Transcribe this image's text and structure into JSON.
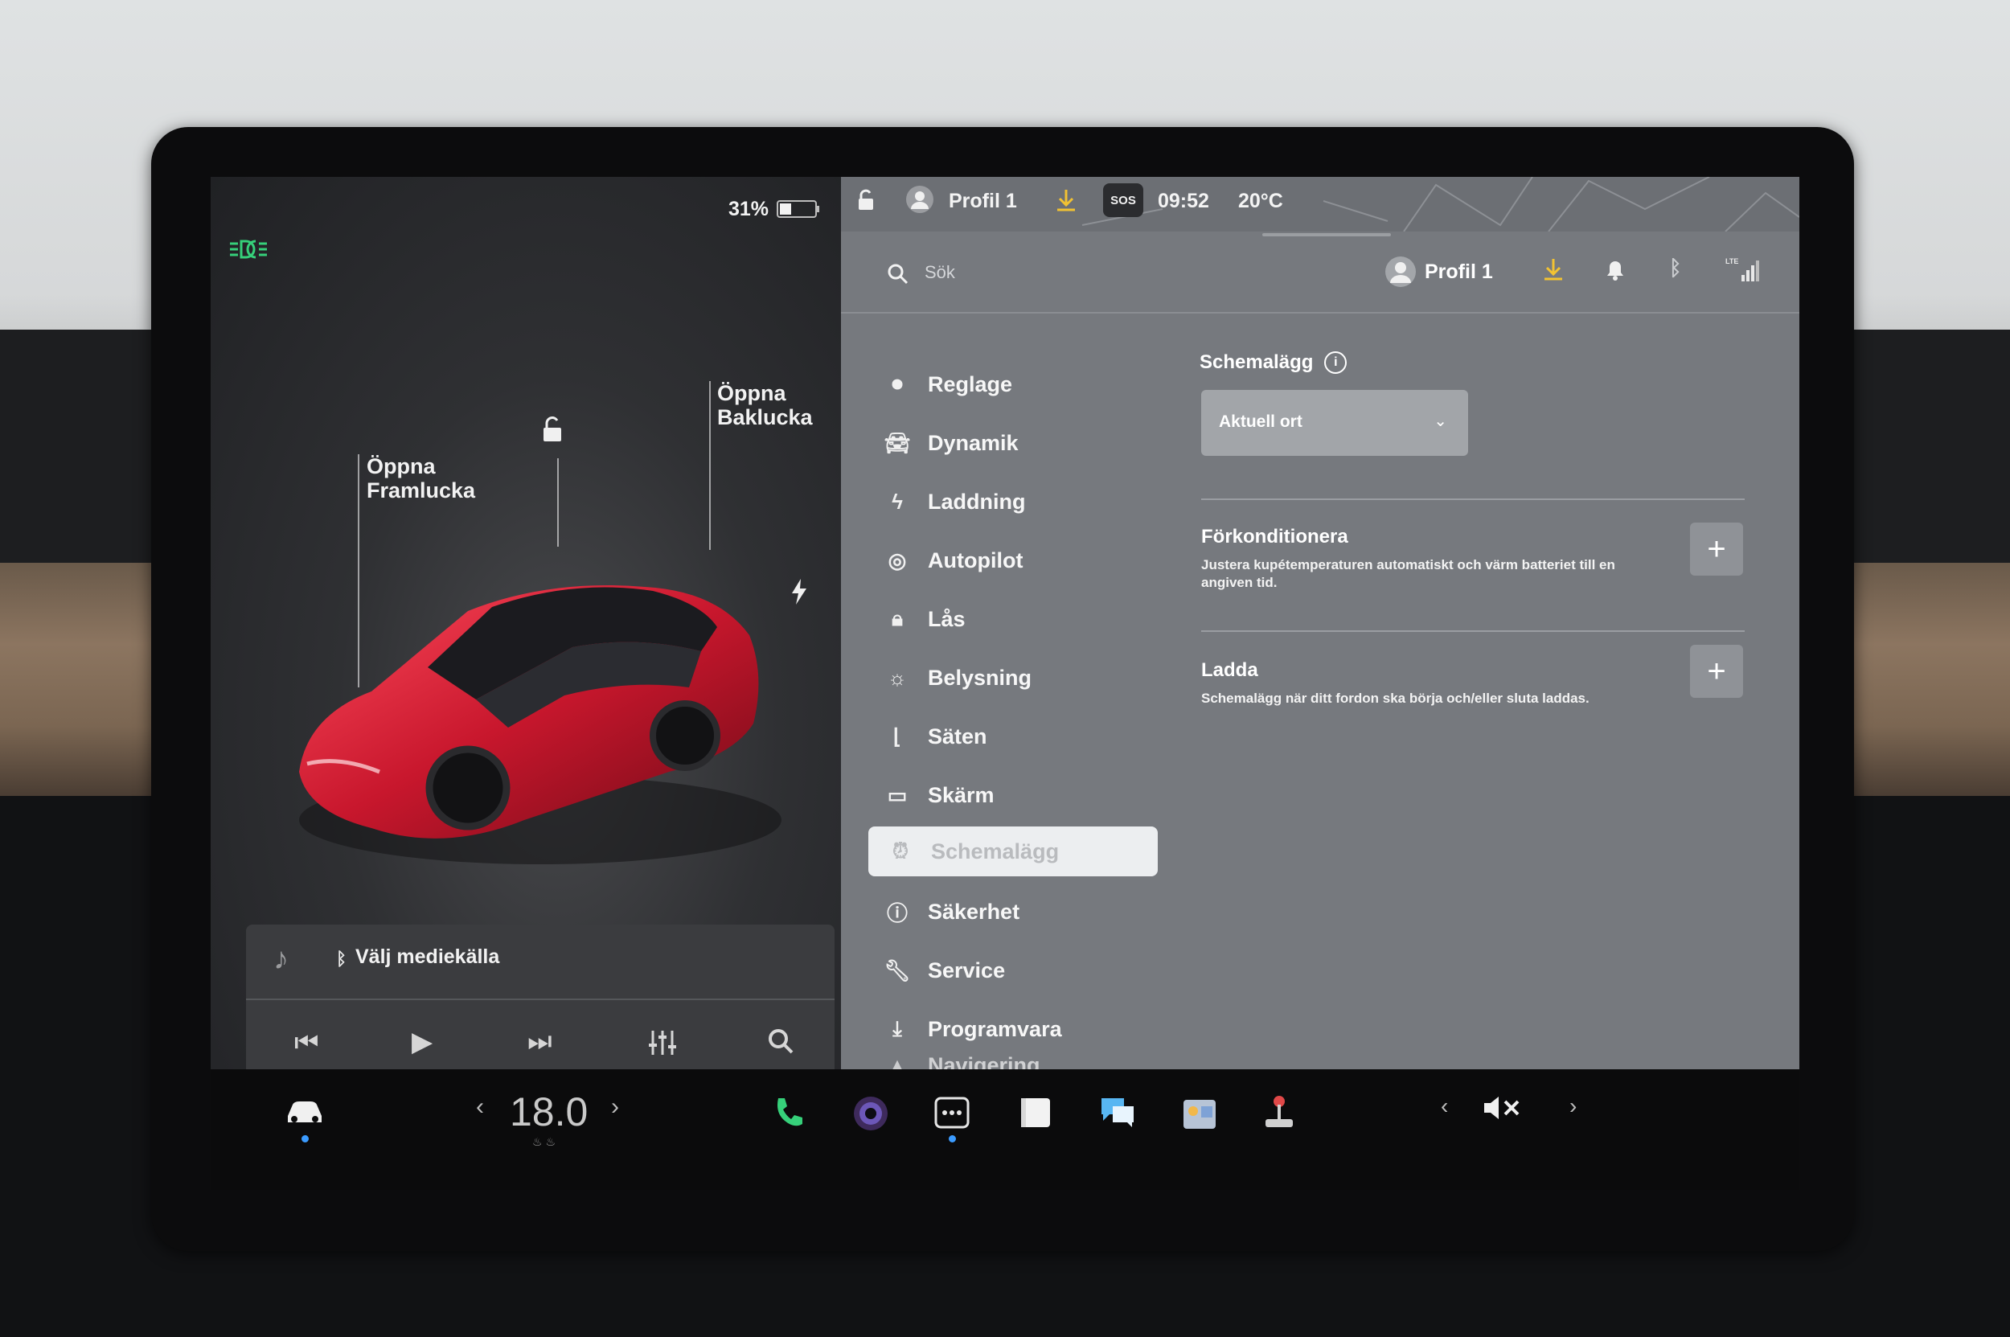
{
  "status": {
    "battery_percent": "31%",
    "profile_top": "Profil 1",
    "sos": "SOS",
    "time": "09:52",
    "temperature_outside": "20°C"
  },
  "car": {
    "front_trunk_label_1": "Öppna",
    "front_trunk_label_2": "Framlucka",
    "rear_trunk_label_1": "Öppna",
    "rear_trunk_label_2": "Baklucka"
  },
  "search": {
    "placeholder": "Sök"
  },
  "header": {
    "profile": "Profil 1"
  },
  "menu": {
    "items": [
      {
        "label": "Reglage",
        "icon": "toggle-icon"
      },
      {
        "label": "Dynamik",
        "icon": "car-icon"
      },
      {
        "label": "Laddning",
        "icon": "bolt-icon"
      },
      {
        "label": "Autopilot",
        "icon": "steering-wheel-icon"
      },
      {
        "label": "Lås",
        "icon": "lock-icon"
      },
      {
        "label": "Belysning",
        "icon": "sun-icon"
      },
      {
        "label": "Säten",
        "icon": "seat-icon"
      },
      {
        "label": "Skärm",
        "icon": "screen-icon"
      },
      {
        "label": "Schemalägg",
        "icon": "alarm-clock-icon",
        "active": true
      },
      {
        "label": "Säkerhet",
        "icon": "alert-icon"
      },
      {
        "label": "Service",
        "icon": "wrench-icon"
      },
      {
        "label": "Programvara",
        "icon": "download-icon"
      },
      {
        "label": "Navigering",
        "icon": "navigation-icon"
      }
    ]
  },
  "schedule": {
    "title": "Schemalägg",
    "location_value": "Aktuell ort",
    "precondition_title": "Förkonditionera",
    "precondition_desc": "Justera kupétemperaturen automatiskt och värm batteriet till en angiven tid.",
    "charge_title": "Ladda",
    "charge_desc": "Schemalägg när ditt fordon ska börja och/eller sluta laddas."
  },
  "media": {
    "source": "Välj mediekälla"
  },
  "climate": {
    "temperature": "18.0"
  },
  "colors": {
    "accent_green": "#36d07a",
    "download_yellow": "#f2c232",
    "car_red": "#c8172d"
  }
}
